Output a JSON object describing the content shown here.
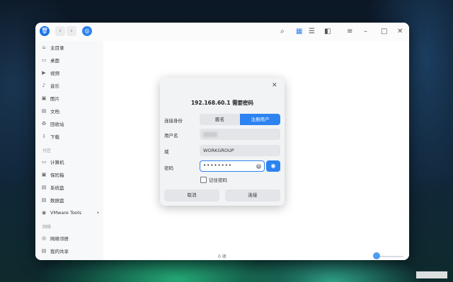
{
  "titlebar": {
    "icons": [
      "trash-icon",
      "back-icon",
      "forward-icon",
      "network-app-icon",
      "search-icon",
      "icon-view-icon",
      "list-view-icon",
      "preview-pane-icon",
      "menu-icon",
      "minimize-icon",
      "maximize-icon",
      "close-icon"
    ],
    "back": "‹",
    "forward": "›",
    "search": "⌕",
    "view_icons": "▦",
    "view_list": "☰",
    "pane": "◧",
    "menu": "≡",
    "minimize": "–",
    "maximize": "□",
    "close": "✕"
  },
  "sidebar": {
    "items_top": [
      {
        "label": "主目录",
        "icon": "⌂"
      },
      {
        "label": "桌面",
        "icon": "▭"
      },
      {
        "label": "视频",
        "icon": "▶"
      },
      {
        "label": "音乐",
        "icon": "♪"
      },
      {
        "label": "图片",
        "icon": "▣"
      },
      {
        "label": "文档",
        "icon": "▤"
      },
      {
        "label": "回收站",
        "icon": "♻"
      },
      {
        "label": "下载",
        "icon": "⇩"
      }
    ],
    "group_partition": "分区",
    "items_partition": [
      {
        "label": "计算机",
        "icon": "▭"
      },
      {
        "label": "保险箱",
        "icon": "▣"
      },
      {
        "label": "系统盘",
        "icon": "▤"
      },
      {
        "label": "数据盘",
        "icon": "▤"
      },
      {
        "label": "VMware Tools",
        "icon": "◉",
        "arrow": "▸"
      }
    ],
    "group_network": "网络",
    "items_network": [
      {
        "label": "网络邻居",
        "icon": "◎"
      },
      {
        "label": "我的共享",
        "icon": "▤"
      }
    ]
  },
  "status": {
    "count": "0 项"
  },
  "dialog": {
    "close": "✕",
    "title": "192.168.60.1 需要密码",
    "connect_as_label": "连接身份",
    "anonymous": "匿名",
    "registered_user": "注册用户",
    "username_label": "用户名",
    "domain_label": "域",
    "domain_value": "WORKGROUP",
    "password_label": "密码",
    "password_value": "••••••••",
    "clear": "✕",
    "eye": "◉",
    "remember": "记住密码",
    "cancel": "取消",
    "connect": "连接"
  },
  "colors": {
    "accent": "#2d83f0",
    "window_bg": "#f7f8fa",
    "dialog_bg": "#f2f3f5"
  }
}
